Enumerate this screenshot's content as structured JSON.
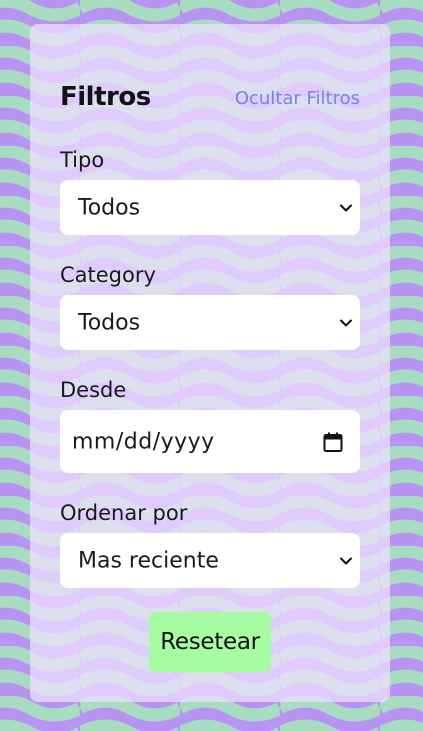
{
  "panel": {
    "title": "Filtros",
    "hide_link": "Ocultar Filtros"
  },
  "fields": {
    "tipo": {
      "label": "Tipo",
      "value": "Todos"
    },
    "category": {
      "label": "Category",
      "value": "Todos"
    },
    "desde": {
      "label": "Desde",
      "placeholder": "mm/dd/yyyy"
    },
    "ordenar": {
      "label": "Ordenar por",
      "value": "Mas reciente"
    }
  },
  "reset_button": "Resetear",
  "icons": {
    "select_arrow": "chevron-down-icon",
    "date_picker": "calendar-icon"
  },
  "colors": {
    "background": "#b993f3",
    "wave": "#a8dcc0",
    "panel": "#eee0ff",
    "link": "#6f88e6",
    "reset_button": "#a6fca0"
  }
}
